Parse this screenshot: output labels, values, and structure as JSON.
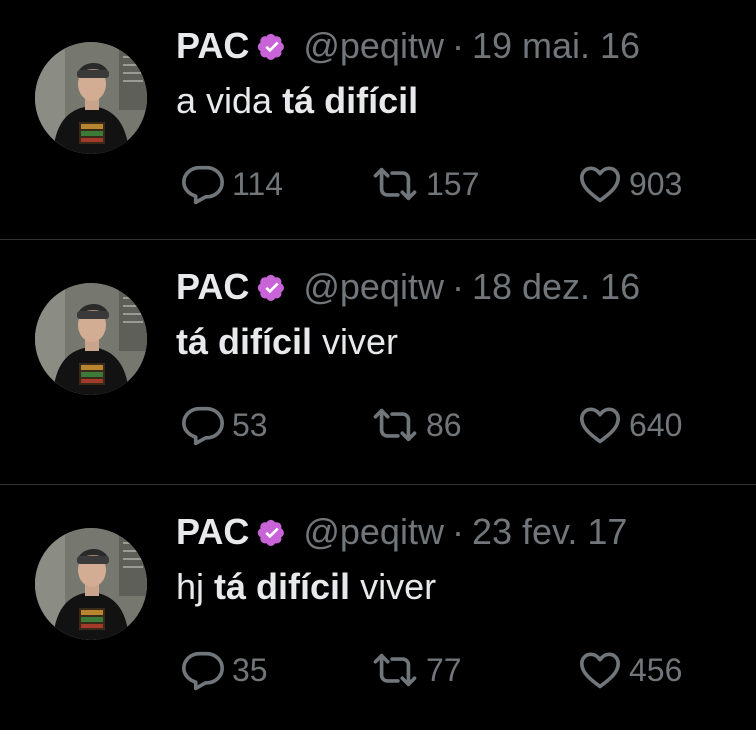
{
  "colors": {
    "background": "#000000",
    "text_primary": "#e7e9ea",
    "text_secondary": "#71767b",
    "verified_badge": "#c964d8",
    "divider": "#2f3336"
  },
  "icons": {
    "reply": "speech-bubble",
    "retweet": "retweet-arrows",
    "like": "heart",
    "verified": "verified-badge"
  },
  "tweets": [
    {
      "name": "PAC",
      "handle": "@peqitw",
      "separator": "·",
      "date": "19 mai. 16",
      "text_before": "a vida ",
      "text_bold": "tá difícil",
      "text_after": "",
      "replies": "114",
      "retweets": "157",
      "likes": "903"
    },
    {
      "name": "PAC",
      "handle": "@peqitw",
      "separator": "·",
      "date": "18 dez. 16",
      "text_before": "",
      "text_bold": "tá difícil",
      "text_after": " viver",
      "replies": "53",
      "retweets": "86",
      "likes": "640"
    },
    {
      "name": "PAC",
      "handle": "@peqitw",
      "separator": "·",
      "date": "23 fev. 17",
      "text_before": "hj ",
      "text_bold": "tá difícil",
      "text_after": " viver",
      "replies": "35",
      "retweets": "77",
      "likes": "456"
    }
  ]
}
